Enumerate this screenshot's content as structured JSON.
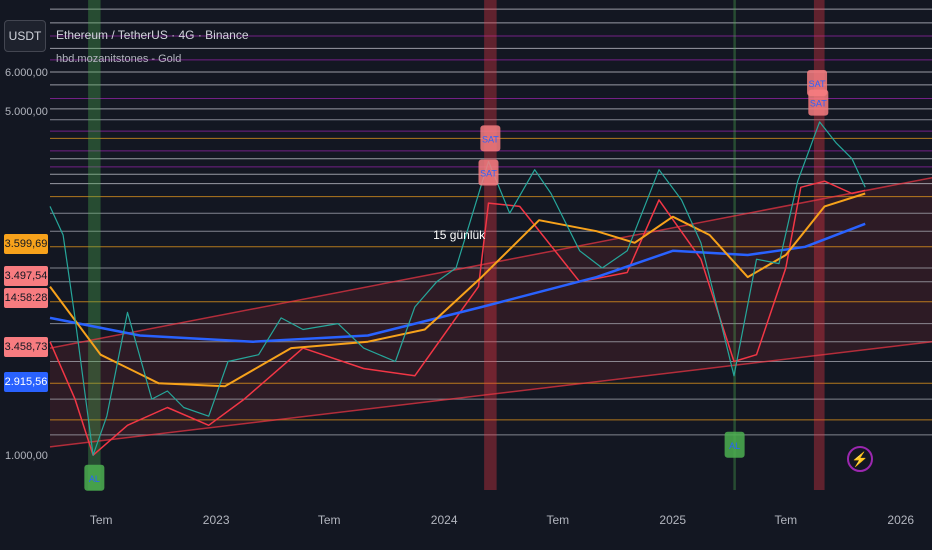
{
  "header": {
    "currency_label": "USDT",
    "title": "Ethereum / TetherUS · 4G · Binance",
    "indicator": "hbd.mozanitstones - Gold"
  },
  "price_badges": [
    {
      "label": "3.599,69",
      "price": 3599.69,
      "bg": "#f7a21b"
    },
    {
      "label": "3.497,54",
      "price": 3497.54,
      "bg": "#f77c80"
    },
    {
      "label": "14:58:28",
      "price": 3420,
      "bg": "#f77c80"
    },
    {
      "label": "3.458,73",
      "price": 3458.73,
      "bg": "#f77c80"
    },
    {
      "label": "2.915,56",
      "price": 2915.56,
      "bg": "#2962ff"
    }
  ],
  "chart_data": {
    "type": "line",
    "y_scale": "log",
    "ylim": [
      850,
      8400
    ],
    "y_ticks": [
      {
        "label": "1.000,00",
        "value": 1000
      },
      {
        "label": "5.000,00",
        "value": 5000
      },
      {
        "label": "6.000,00",
        "value": 6000
      }
    ],
    "x_ticks": [
      {
        "label": "Tem",
        "date": "2022-07-01"
      },
      {
        "label": "2023",
        "date": "2023-01-01"
      },
      {
        "label": "Tem",
        "date": "2023-07-01"
      },
      {
        "label": "2024",
        "date": "2024-01-01"
      },
      {
        "label": "Tem",
        "date": "2024-07-01"
      },
      {
        "label": "2025",
        "date": "2025-01-01"
      },
      {
        "label": "Tem",
        "date": "2025-07-01"
      },
      {
        "label": "2026",
        "date": "2026-01-01"
      }
    ],
    "xlim": [
      "2022-04-10",
      "2026-02-20"
    ],
    "horizontal_levels": [
      {
        "value": 1100,
        "color": "#b2b5be"
      },
      {
        "value": 1180,
        "color": "#f7a21b"
      },
      {
        "value": 1300,
        "color": "#b2b5be"
      },
      {
        "value": 1400,
        "color": "#f7a21b"
      },
      {
        "value": 1550,
        "color": "#b2b5be"
      },
      {
        "value": 1700,
        "color": "#b2b5be"
      },
      {
        "value": 1850,
        "color": "#b2b5be"
      },
      {
        "value": 2050,
        "color": "#f7a21b"
      },
      {
        "value": 2250,
        "color": "#b2b5be"
      },
      {
        "value": 2400,
        "color": "#b2b5be"
      },
      {
        "value": 2650,
        "color": "#f7a21b"
      },
      {
        "value": 2850,
        "color": "#b2b5be"
      },
      {
        "value": 3100,
        "color": "#b2b5be"
      },
      {
        "value": 3350,
        "color": "#f7a21b"
      },
      {
        "value": 3560,
        "color": "#d1d4dc"
      },
      {
        "value": 3720,
        "color": "#d1d4dc"
      },
      {
        "value": 3850,
        "color": "#9c27b0"
      },
      {
        "value": 4000,
        "color": "#d1d4dc"
      },
      {
        "value": 4150,
        "color": "#9c27b0"
      },
      {
        "value": 4400,
        "color": "#f7a21b"
      },
      {
        "value": 4550,
        "color": "#9c27b0"
      },
      {
        "value": 4800,
        "color": "#b2b5be"
      },
      {
        "value": 5050,
        "color": "#d1d4dc"
      },
      {
        "value": 5300,
        "color": "#9c27b0"
      },
      {
        "value": 5650,
        "color": "#d1d4dc"
      },
      {
        "value": 6000,
        "color": "#d1d4dc"
      },
      {
        "value": 6350,
        "color": "#9c27b0"
      },
      {
        "value": 6700,
        "color": "#d1d4dc"
      },
      {
        "value": 7100,
        "color": "#9c27b0"
      },
      {
        "value": 7550,
        "color": "#d1d4dc"
      },
      {
        "value": 8050,
        "color": "#d1d4dc"
      }
    ],
    "channel": {
      "upper": [
        {
          "date": "2022-04-10",
          "value": 1650
        },
        {
          "date": "2026-02-20",
          "value": 3660
        }
      ],
      "lower": [
        {
          "date": "2022-04-10",
          "value": 1040
        },
        {
          "date": "2026-02-20",
          "value": 1700
        }
      ],
      "color": "#f23645"
    },
    "vertical_zones": [
      {
        "start": "2022-06-10",
        "end": "2022-06-30",
        "color": "#4caf50"
      },
      {
        "start": "2024-03-05",
        "end": "2024-03-25",
        "color": "#f23645"
      },
      {
        "start": "2025-04-08",
        "end": "2025-04-12",
        "color": "#4caf50"
      },
      {
        "start": "2025-08-15",
        "end": "2025-09-01",
        "color": "#f23645"
      }
    ],
    "price_series": {
      "name": "",
      "color": "#26a69a",
      "dates": [
        "2022-04-10",
        "2022-05-01",
        "2022-05-20",
        "2022-06-18",
        "2022-07-10",
        "2022-08-12",
        "2022-09-20",
        "2022-10-15",
        "2022-11-10",
        "2022-12-20",
        "2023-01-20",
        "2023-03-10",
        "2023-04-15",
        "2023-05-20",
        "2023-07-15",
        "2023-08-25",
        "2023-10-15",
        "2023-11-15",
        "2023-12-20",
        "2024-01-20",
        "2024-03-12",
        "2024-04-15",
        "2024-05-25",
        "2024-06-20",
        "2024-08-05",
        "2024-09-10",
        "2024-10-20",
        "2024-12-10",
        "2025-01-15",
        "2025-02-15",
        "2025-03-15",
        "2025-04-09",
        "2025-05-15",
        "2025-06-20",
        "2025-07-20",
        "2025-08-24",
        "2025-09-20",
        "2025-10-15",
        "2025-11-05"
      ],
      "values": [
        3200,
        2800,
        1900,
        1000,
        1200,
        1950,
        1300,
        1350,
        1250,
        1200,
        1550,
        1600,
        1900,
        1800,
        1850,
        1650,
        1550,
        2000,
        2250,
        2400,
        3950,
        3100,
        3800,
        3400,
        2600,
        2400,
        2600,
        3800,
        3300,
        2700,
        1950,
        1450,
        2500,
        2450,
        3600,
        4750,
        4300,
        4000,
        3500
      ]
    },
    "ema_fast": {
      "color": "#f7a21b",
      "dates": [
        "2022-04-10",
        "2022-06-30",
        "2022-10-01",
        "2023-01-15",
        "2023-05-01",
        "2023-09-01",
        "2023-12-01",
        "2024-03-01",
        "2024-06-01",
        "2024-09-01",
        "2024-11-01",
        "2025-01-01",
        "2025-03-01",
        "2025-05-01",
        "2025-07-01",
        "2025-09-01",
        "2025-11-05"
      ],
      "values": [
        2200,
        1600,
        1400,
        1380,
        1650,
        1700,
        1800,
        2300,
        3000,
        2850,
        2700,
        3050,
        2800,
        2300,
        2550,
        3200,
        3400
      ]
    },
    "ema_slow": {
      "color": "#2962ff",
      "dates": [
        "2022-04-10",
        "2022-09-01",
        "2023-03-01",
        "2023-09-01",
        "2024-03-01",
        "2024-09-01",
        "2025-01-01",
        "2025-05-01",
        "2025-08-01",
        "2025-11-05"
      ],
      "values": [
        1900,
        1750,
        1700,
        1750,
        2000,
        2300,
        2600,
        2550,
        2650,
        2950
      ]
    },
    "trailing": {
      "color": "#f23645",
      "dates": [
        "2022-04-10",
        "2022-05-20",
        "2022-06-18",
        "2022-08-12",
        "2022-10-15",
        "2022-12-20",
        "2023-02-15",
        "2023-05-20",
        "2023-08-25",
        "2023-11-15",
        "2024-01-20",
        "2024-02-25",
        "2024-03-12",
        "2024-05-01",
        "2024-08-05",
        "2024-10-20",
        "2024-12-10",
        "2025-02-15",
        "2025-04-09",
        "2025-05-15",
        "2025-07-01",
        "2025-07-25",
        "2025-09-01",
        "2025-10-15",
        "2025-11-05"
      ],
      "values": [
        1700,
        1300,
        1000,
        1150,
        1250,
        1150,
        1300,
        1650,
        1500,
        1450,
        1900,
        2200,
        3250,
        3200,
        2250,
        2350,
        3300,
        2500,
        1550,
        1600,
        2400,
        3500,
        3600,
        3400,
        3450
      ]
    },
    "labels": [
      {
        "text": "15 günlük",
        "date": "2024-01-25",
        "value": 2750,
        "color": "#ffffff"
      },
      {
        "text": "AL",
        "date": "2022-06-20",
        "value": 900,
        "color": "#4caf50"
      },
      {
        "text": "SAT",
        "date": "2024-03-15",
        "value": 4400,
        "color": "#f77c80"
      },
      {
        "text": "SAT",
        "date": "2024-03-12",
        "value": 3750,
        "color": "#f77c80"
      },
      {
        "text": "AL",
        "date": "2025-04-10",
        "value": 1050,
        "color": "#4caf50"
      },
      {
        "text": "SAT",
        "date": "2025-08-20",
        "value": 5700,
        "color": "#f77c80"
      },
      {
        "text": "SAT",
        "date": "2025-08-22",
        "value": 5200,
        "color": "#f77c80"
      }
    ]
  }
}
